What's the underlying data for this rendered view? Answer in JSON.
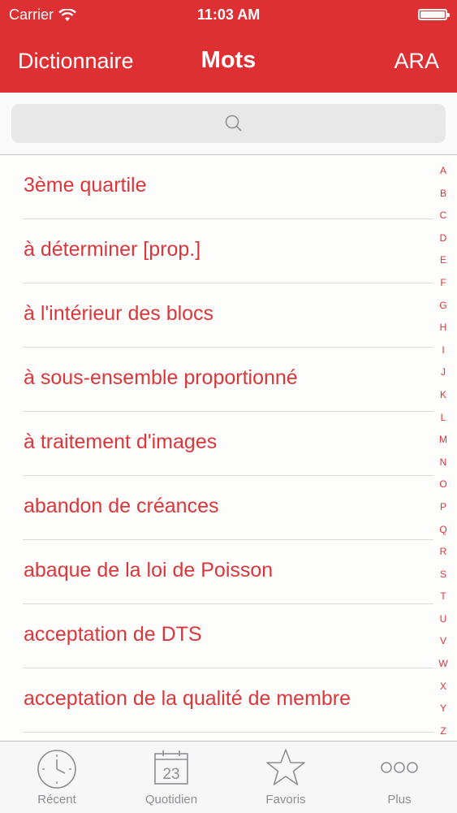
{
  "status": {
    "carrier": "Carrier",
    "time": "11:03 AM"
  },
  "nav": {
    "left": "Dictionnaire",
    "title": "Mots",
    "right": "ARA"
  },
  "search": {
    "placeholder": ""
  },
  "words": [
    "3ème quartile",
    "à déterminer [prop.]",
    "à l'intérieur des blocs",
    "à sous-ensemble proportionné",
    "à traitement d'images",
    "abandon de créances",
    "abaque de la loi de Poisson",
    "acceptation de DTS",
    "acceptation de la qualité de membre"
  ],
  "index": [
    "A",
    "B",
    "C",
    "D",
    "E",
    "F",
    "G",
    "H",
    "I",
    "J",
    "K",
    "L",
    "M",
    "N",
    "O",
    "P",
    "Q",
    "R",
    "S",
    "T",
    "U",
    "V",
    "W",
    "X",
    "Y",
    "Z"
  ],
  "tabs": {
    "recent": "Récent",
    "daily": "Quotidien",
    "daily_date": "23",
    "favorites": "Favoris",
    "more": "Plus"
  },
  "colors": {
    "accent": "#de2f32",
    "text_red": "#d9373b",
    "tab_gray": "#8e8e93"
  }
}
